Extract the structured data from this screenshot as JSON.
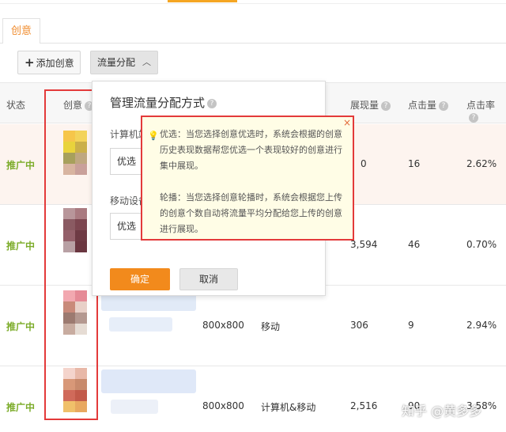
{
  "tabs": {
    "creative": "创意"
  },
  "toolbar": {
    "add_label": "添加创意",
    "flow_label": "流量分配"
  },
  "table": {
    "headers": {
      "status": "状态",
      "creative": "创意",
      "impressions": "展现量",
      "clicks": "点击量",
      "ctr": "点击率"
    },
    "rows": [
      {
        "status": "推广中",
        "size": "",
        "device": "",
        "impressions": "0",
        "clicks": "16",
        "ctr": "2.62%"
      },
      {
        "status": "推广中",
        "size": "",
        "device": "",
        "impressions": "3,594",
        "clicks": "46",
        "ctr": "0.70%"
      },
      {
        "status": "推广中",
        "size": "800x800",
        "device": "移动",
        "impressions": "306",
        "clicks": "9",
        "ctr": "2.94%"
      },
      {
        "status": "推广中",
        "size": "800x800",
        "device": "计算机&移动",
        "impressions": "2,516",
        "clicks": "90",
        "ctr": "3.58%"
      }
    ]
  },
  "popup": {
    "title": "管理流量分配方式",
    "computer_label": "计算机端",
    "computer_value": "优选",
    "mobile_label": "移动设备",
    "mobile_value": "优选",
    "confirm": "确定",
    "cancel": "取消"
  },
  "tooltip": {
    "optimal": "优选：当您选择创意优选时，系统会根据的创意历史表现数据帮您优选一个表现较好的创意进行集中展现。",
    "rotate": "轮播：当您选择创意轮播时，系统会根据您上传的创意个数自动将流量平均分配给您上传的创意进行展现。",
    "close": "×"
  },
  "watermark": "知乎 @黄多多",
  "colors": {
    "accent": "#f28a1c",
    "status_green": "#7cac2a",
    "highlight_red": "#e33a3a",
    "tooltip_bg": "#fffde6"
  }
}
